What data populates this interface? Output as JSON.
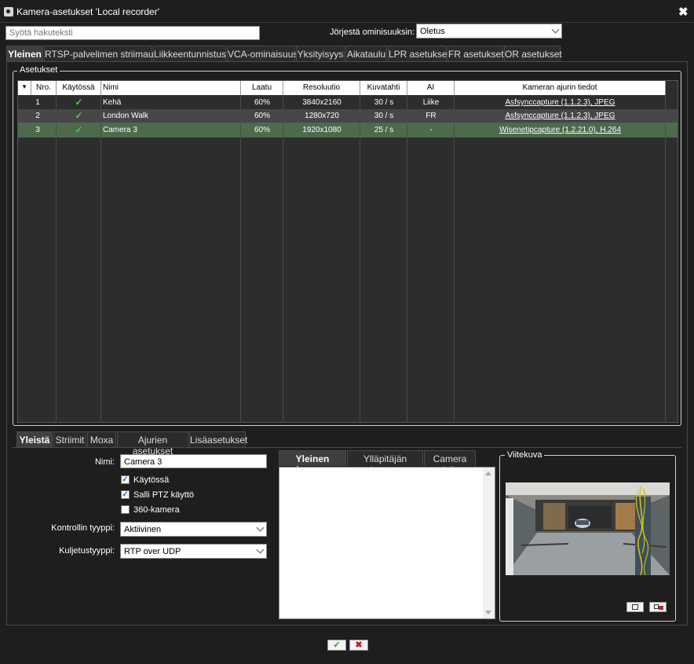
{
  "window": {
    "title": "Kamera-asetukset 'Local recorder'",
    "close": "✖"
  },
  "search": {
    "placeholder": "Syötä hakuteksti"
  },
  "sort": {
    "label": "Jörjestä ominisuuksin:",
    "value": "Oletus"
  },
  "tabs": [
    "Yleinen",
    "RTSP-palvelimen striimaus",
    "Liikkeentunnistus",
    "VCA-ominaisuus",
    "Yksityisyys",
    "Aikataulu",
    "LPR asetukset",
    "FR asetukset",
    "OR asetukset"
  ],
  "settings_group": {
    "legend": "Asetukset"
  },
  "table": {
    "sort_indicator": "▾",
    "headers": [
      "Nro.",
      "Käytössä",
      "Nimi",
      "Laatu",
      "Resoluutio",
      "Kuvatahti",
      "AI",
      "Kameran ajurin tiedot"
    ],
    "rows": [
      {
        "nro": "1",
        "enabled": "✓",
        "name": "Kehä",
        "quality": "60%",
        "resolution": "3840x2160",
        "fps": "30 / s",
        "ai": "Liike",
        "driver": "Asfsynccapture (1.1.2.3), JPEG"
      },
      {
        "nro": "2",
        "enabled": "✓",
        "name": "London Walk",
        "quality": "60%",
        "resolution": "1280x720",
        "fps": "30 / s",
        "ai": "FR",
        "driver": "Asfsynccapture (1.1.2.3), JPEG"
      },
      {
        "nro": "3",
        "enabled": "✓",
        "name": "Camera 3",
        "quality": "60%",
        "resolution": "1920x1080",
        "fps": "25 / s",
        "ai": "-",
        "driver": "Wisenetipcapture (1.2.21.0), H.264"
      }
    ],
    "selected_row": "3"
  },
  "subtabs": [
    "Yleistä",
    "Striimit",
    "Moxa",
    "Ajurien asetukset",
    "Lisäasetukset"
  ],
  "form": {
    "name_label": "Nimi:",
    "name_value": "Camera 3",
    "checkboxes": [
      {
        "label": "Käytössä",
        "checked": "✓"
      },
      {
        "label": "Salli PTZ käyttö",
        "checked": "✓"
      },
      {
        "label": "360-kamera",
        "checked": ""
      }
    ],
    "control_type_label": "Kontrollin tyyppi:",
    "control_type_value": "Aktiivinen",
    "transport_label": "Kuljetustyyppi:",
    "transport_value": "RTP over UDP"
  },
  "desc_tabs": [
    "Yleinen kuvaus",
    "Ylläpitäjän kuvaus",
    "Camera Info"
  ],
  "reference": {
    "legend": "Viitekuva"
  },
  "colors": {
    "accent_row": "#4d6a4d",
    "check": "#4fc84f",
    "ok": "#1c9a1c",
    "cancel": "#cc1a1a"
  },
  "footer": {
    "ok": "✓",
    "cancel": "✖"
  }
}
